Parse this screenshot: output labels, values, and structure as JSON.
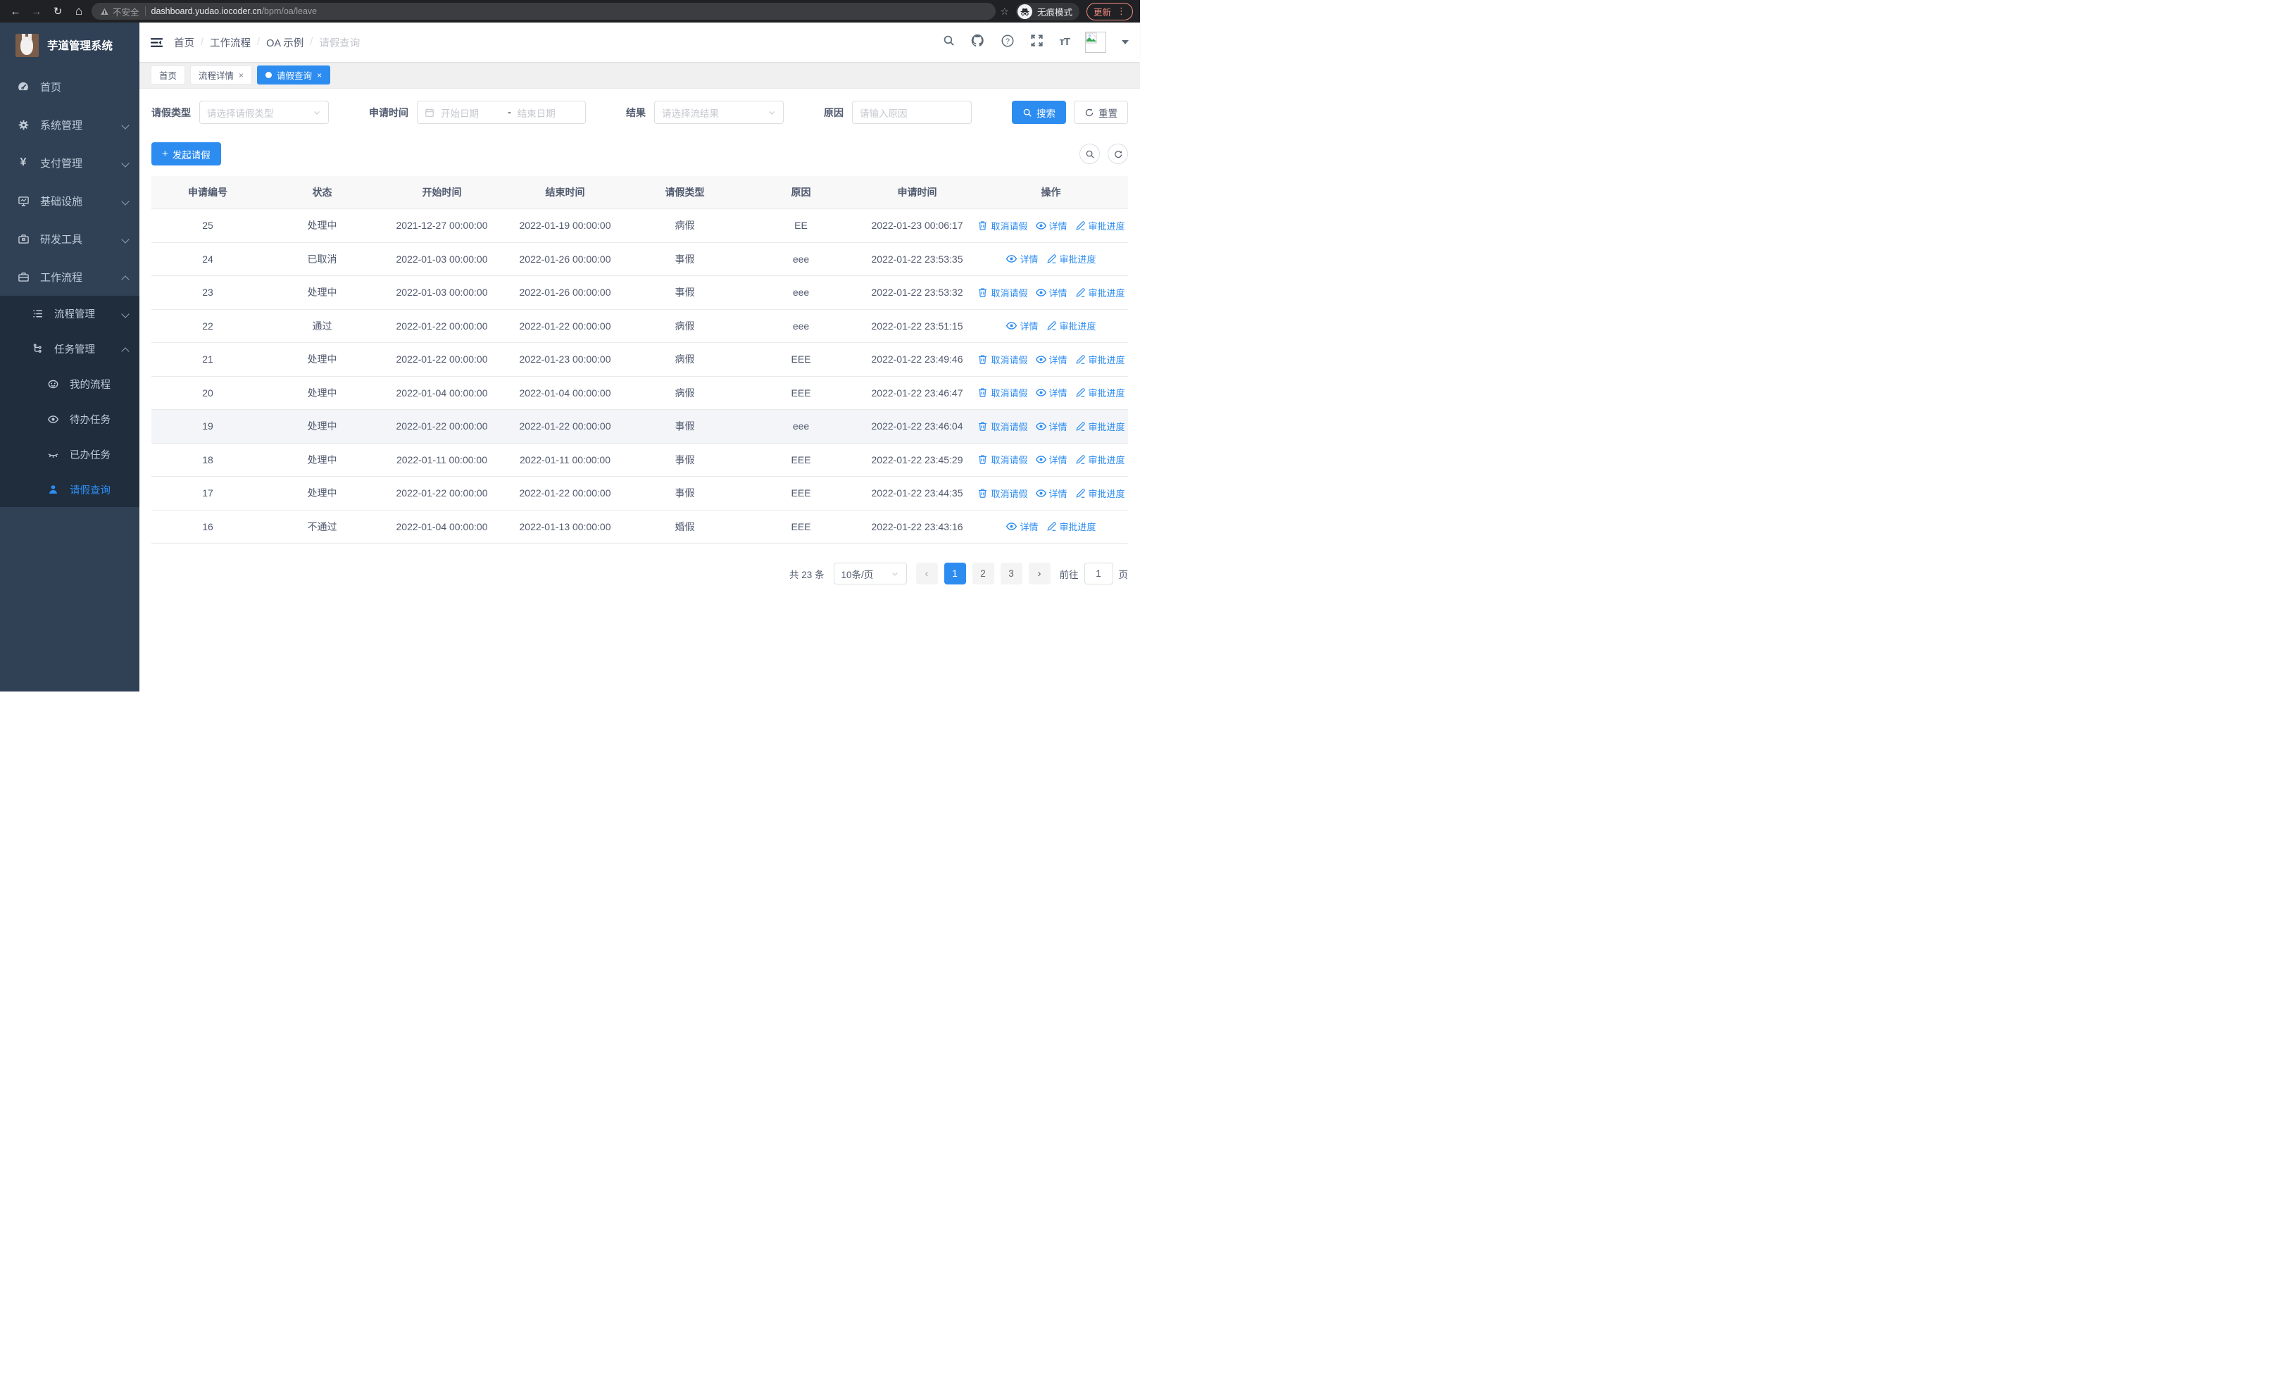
{
  "theme": {
    "primary": "#2d8cf0",
    "sidebar_bg": "#304156",
    "submenu_bg": "#1f2d3d",
    "update_accent": "#f28b82"
  },
  "browser": {
    "security_label": "不安全",
    "url_host": "dashboard.yudao.iocoder.cn",
    "url_path": "/bpm/oa/leave",
    "incognito_label": "无痕模式",
    "update_label": "更新"
  },
  "sidebar": {
    "brand": "芋道管理系统",
    "items": [
      {
        "id": "home",
        "label": "首页",
        "icon": "gauge-icon",
        "level": 0,
        "dark": false,
        "chevron": "",
        "active": false
      },
      {
        "id": "system",
        "label": "系统管理",
        "icon": "gear-icon",
        "level": 0,
        "dark": false,
        "chevron": "down",
        "active": false
      },
      {
        "id": "pay",
        "label": "支付管理",
        "icon": "yen-icon",
        "level": 0,
        "dark": false,
        "chevron": "down",
        "active": false
      },
      {
        "id": "infra",
        "label": "基础设施",
        "icon": "monitor-icon",
        "level": 0,
        "dark": false,
        "chevron": "down",
        "active": false
      },
      {
        "id": "devtools",
        "label": "研发工具",
        "icon": "toolbox-icon",
        "level": 0,
        "dark": false,
        "chevron": "down",
        "active": false
      },
      {
        "id": "workflow",
        "label": "工作流程",
        "icon": "briefcase-icon",
        "level": 0,
        "dark": false,
        "chevron": "up",
        "active": false
      },
      {
        "id": "process-mgmt",
        "label": "流程管理",
        "icon": "list-icon",
        "level": 1,
        "dark": true,
        "chevron": "down",
        "active": false
      },
      {
        "id": "task-mgmt",
        "label": "任务管理",
        "icon": "branch-icon",
        "level": 1,
        "dark": true,
        "chevron": "up",
        "active": false
      },
      {
        "id": "my-process",
        "label": "我的流程",
        "icon": "face-icon",
        "level": 2,
        "dark": true,
        "chevron": "",
        "active": false
      },
      {
        "id": "todo-task",
        "label": "待办任务",
        "icon": "eye-icon",
        "level": 2,
        "dark": true,
        "chevron": "",
        "active": false
      },
      {
        "id": "done-task",
        "label": "已办任务",
        "icon": "eye-off-icon",
        "level": 2,
        "dark": true,
        "chevron": "",
        "active": false
      },
      {
        "id": "leave-query",
        "label": "请假查询",
        "icon": "person-icon",
        "level": 2,
        "dark": true,
        "chevron": "",
        "active": true
      }
    ]
  },
  "header": {
    "breadcrumb": [
      {
        "label": "首页",
        "muted": false
      },
      {
        "label": "工作流程",
        "muted": false
      },
      {
        "label": "OA 示例",
        "muted": false
      },
      {
        "label": "请假查询",
        "muted": true
      }
    ],
    "icons": [
      "search-icon",
      "github-icon",
      "help-icon",
      "fullscreen-icon",
      "font-size-icon"
    ]
  },
  "tabs": [
    {
      "label": "首页",
      "closable": false,
      "active": false
    },
    {
      "label": "流程详情",
      "closable": true,
      "active": false
    },
    {
      "label": "请假查询",
      "closable": true,
      "active": true
    }
  ],
  "filters": {
    "leave_type_label": "请假类型",
    "leave_type_placeholder": "请选择请假类型",
    "apply_time_label": "申请时间",
    "date_start_placeholder": "开始日期",
    "date_separator": "-",
    "date_end_placeholder": "结束日期",
    "result_label": "结果",
    "result_placeholder": "请选择流结果",
    "reason_label": "原因",
    "reason_placeholder": "请输入原因",
    "search_label": "搜索",
    "reset_label": "重置"
  },
  "toolbar": {
    "create_label": "发起请假"
  },
  "table": {
    "columns": [
      "申请编号",
      "状态",
      "开始时间",
      "结束时间",
      "请假类型",
      "原因",
      "申请时间",
      "操作"
    ],
    "action_defs": {
      "cancel": {
        "label": "取消请假",
        "icon": "trash-icon"
      },
      "detail": {
        "label": "详情",
        "icon": "eye-icon"
      },
      "progress": {
        "label": "审批进度",
        "icon": "pen-icon"
      }
    },
    "rows": [
      {
        "id": "25",
        "status": "处理中",
        "start": "2021-12-27 00:00:00",
        "end": "2022-01-19 00:00:00",
        "type": "病假",
        "reason": "EE",
        "apply_time": "2022-01-23 00:06:17",
        "actions": [
          "cancel",
          "detail",
          "progress"
        ],
        "hovered": false
      },
      {
        "id": "24",
        "status": "已取消",
        "start": "2022-01-03 00:00:00",
        "end": "2022-01-26 00:00:00",
        "type": "事假",
        "reason": "eee",
        "apply_time": "2022-01-22 23:53:35",
        "actions": [
          "detail",
          "progress"
        ],
        "hovered": false
      },
      {
        "id": "23",
        "status": "处理中",
        "start": "2022-01-03 00:00:00",
        "end": "2022-01-26 00:00:00",
        "type": "事假",
        "reason": "eee",
        "apply_time": "2022-01-22 23:53:32",
        "actions": [
          "cancel",
          "detail",
          "progress"
        ],
        "hovered": false
      },
      {
        "id": "22",
        "status": "通过",
        "start": "2022-01-22 00:00:00",
        "end": "2022-01-22 00:00:00",
        "type": "病假",
        "reason": "eee",
        "apply_time": "2022-01-22 23:51:15",
        "actions": [
          "detail",
          "progress"
        ],
        "hovered": false
      },
      {
        "id": "21",
        "status": "处理中",
        "start": "2022-01-22 00:00:00",
        "end": "2022-01-23 00:00:00",
        "type": "病假",
        "reason": "EEE",
        "apply_time": "2022-01-22 23:49:46",
        "actions": [
          "cancel",
          "detail",
          "progress"
        ],
        "hovered": false
      },
      {
        "id": "20",
        "status": "处理中",
        "start": "2022-01-04 00:00:00",
        "end": "2022-01-04 00:00:00",
        "type": "病假",
        "reason": "EEE",
        "apply_time": "2022-01-22 23:46:47",
        "actions": [
          "cancel",
          "detail",
          "progress"
        ],
        "hovered": false
      },
      {
        "id": "19",
        "status": "处理中",
        "start": "2022-01-22 00:00:00",
        "end": "2022-01-22 00:00:00",
        "type": "事假",
        "reason": "eee",
        "apply_time": "2022-01-22 23:46:04",
        "actions": [
          "cancel",
          "detail",
          "progress"
        ],
        "hovered": true
      },
      {
        "id": "18",
        "status": "处理中",
        "start": "2022-01-11 00:00:00",
        "end": "2022-01-11 00:00:00",
        "type": "事假",
        "reason": "EEE",
        "apply_time": "2022-01-22 23:45:29",
        "actions": [
          "cancel",
          "detail",
          "progress"
        ],
        "hovered": false
      },
      {
        "id": "17",
        "status": "处理中",
        "start": "2022-01-22 00:00:00",
        "end": "2022-01-22 00:00:00",
        "type": "事假",
        "reason": "EEE",
        "apply_time": "2022-01-22 23:44:35",
        "actions": [
          "cancel",
          "detail",
          "progress"
        ],
        "hovered": false
      },
      {
        "id": "16",
        "status": "不通过",
        "start": "2022-01-04 00:00:00",
        "end": "2022-01-13 00:00:00",
        "type": "婚假",
        "reason": "EEE",
        "apply_time": "2022-01-22 23:43:16",
        "actions": [
          "detail",
          "progress"
        ],
        "hovered": false
      }
    ]
  },
  "pagination": {
    "total_label": "共 23 条",
    "page_size_label": "10条/页",
    "prev_label": "‹",
    "next_label": "›",
    "pages": [
      "1",
      "2",
      "3"
    ],
    "current_page": "1",
    "goto_label": "前往",
    "goto_value": "1",
    "unit_label": "页"
  }
}
